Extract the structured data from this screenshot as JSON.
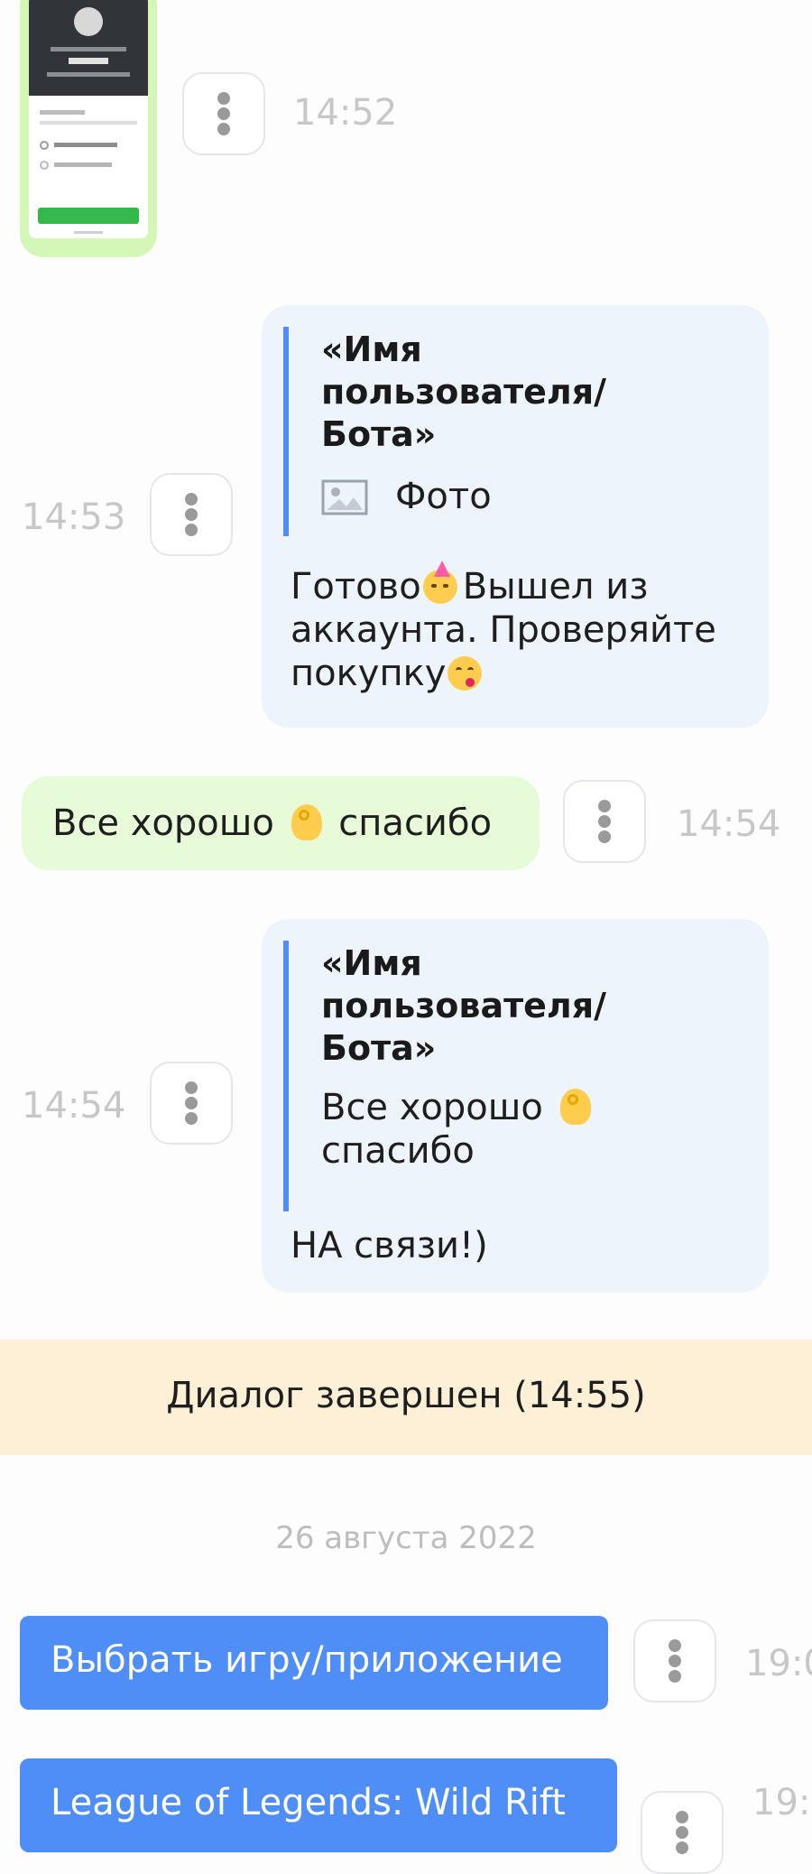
{
  "messages": [
    {
      "id": "photo_message",
      "time": "14:52"
    },
    {
      "id": "reply_done",
      "time": "14:53",
      "quote": {
        "name": "«Имя пользователя/ Бота»",
        "name_lines": [
          "«Имя",
          "пользователя/",
          "Бота»"
        ],
        "attachment_label": "Фото",
        "attachment_icon": "image-icon"
      },
      "text_lines": [
        "Готово",
        "Вышел из",
        "аккаунта. Проверяйте",
        "покупку"
      ],
      "text_full": "Готово🥳 Вышел из аккаунта. Проверяйте покупку😋"
    },
    {
      "id": "user_thanks",
      "time": "14:54",
      "text_parts": [
        "Все хорошо",
        "спасибо"
      ],
      "text_full": "Все хорошо 👌 спасибо"
    },
    {
      "id": "reply_on_contact",
      "time": "14:54",
      "quote": {
        "name_lines": [
          "«Имя",
          "пользователя/",
          "Бота»"
        ],
        "text_lines": [
          "Все хорошо",
          "спасибо"
        ]
      },
      "text": "НА связи!)"
    }
  ],
  "dialog_status": "Диалог завершен (14:55)",
  "date_separator": "26 августа 2022",
  "bot_buttons": [
    {
      "label": "Выбрать игру/приложение",
      "time": "19:0"
    },
    {
      "label": "League of Legends: Wild Rift",
      "time": "19:"
    }
  ],
  "colors": {
    "incoming_bubble": "#eef4fc",
    "outgoing_bubble": "#e8fbd9",
    "quote_bar": "#4f8ef7",
    "status_banner": "#fdf0d6",
    "bot_button": "#4f8ef7",
    "timestamp": "#c7c7c7"
  }
}
